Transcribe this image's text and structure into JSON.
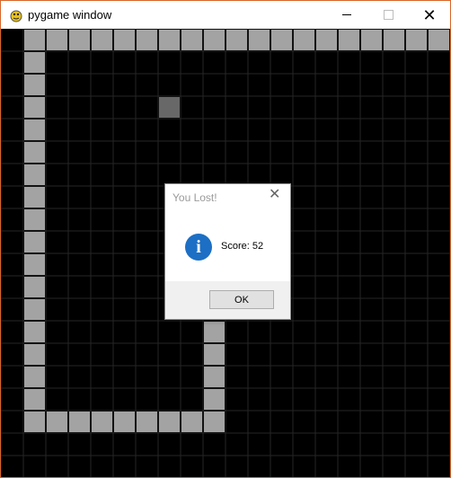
{
  "window": {
    "title": "pygame window",
    "icon": "pygame-snake-icon",
    "controls": {
      "minimize_icon": "minimize-icon",
      "maximize_icon": "maximize-icon",
      "close_icon": "close-icon",
      "close_glyph": "✕"
    }
  },
  "game": {
    "cols": 20,
    "rows": 20,
    "colors": {
      "background": "#000000",
      "grid_line": "#262626",
      "snake": "#a3a3a3",
      "food": "#686868"
    },
    "corner_mark": "◆◆",
    "snake_cells": [
      [
        1,
        0
      ],
      [
        2,
        0
      ],
      [
        3,
        0
      ],
      [
        4,
        0
      ],
      [
        5,
        0
      ],
      [
        6,
        0
      ],
      [
        7,
        0
      ],
      [
        8,
        0
      ],
      [
        9,
        0
      ],
      [
        10,
        0
      ],
      [
        11,
        0
      ],
      [
        12,
        0
      ],
      [
        13,
        0
      ],
      [
        14,
        0
      ],
      [
        15,
        0
      ],
      [
        16,
        0
      ],
      [
        17,
        0
      ],
      [
        18,
        0
      ],
      [
        19,
        0
      ],
      [
        1,
        1
      ],
      [
        1,
        2
      ],
      [
        1,
        3
      ],
      [
        1,
        4
      ],
      [
        1,
        5
      ],
      [
        1,
        6
      ],
      [
        1,
        7
      ],
      [
        1,
        8
      ],
      [
        1,
        9
      ],
      [
        1,
        10
      ],
      [
        1,
        11
      ],
      [
        1,
        12
      ],
      [
        1,
        13
      ],
      [
        1,
        14
      ],
      [
        1,
        15
      ],
      [
        1,
        16
      ],
      [
        1,
        17
      ],
      [
        2,
        17
      ],
      [
        3,
        17
      ],
      [
        4,
        17
      ],
      [
        5,
        17
      ],
      [
        6,
        17
      ],
      [
        7,
        17
      ],
      [
        8,
        17
      ],
      [
        9,
        17
      ],
      [
        9,
        16
      ],
      [
        9,
        15
      ],
      [
        9,
        14
      ],
      [
        9,
        13
      ],
      [
        9,
        12
      ]
    ],
    "food_cell": [
      7,
      3
    ]
  },
  "dialog": {
    "title": "You Lost!",
    "close_glyph": "✕",
    "icon": "info-icon",
    "icon_glyph": "i",
    "message": "Score: 52",
    "ok_label": "OK"
  }
}
